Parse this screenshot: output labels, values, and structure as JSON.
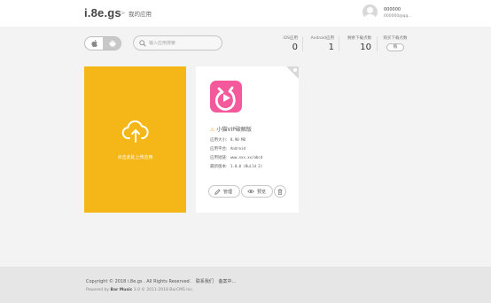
{
  "header": {
    "logo": "i.8e.gs",
    "separator": ">",
    "breadcrumb": "我的应用",
    "user_name": "000000",
    "user_email": "000000@qq..."
  },
  "toolbar": {
    "search_placeholder": "输入应用搜索"
  },
  "stats": [
    {
      "label": "iOS应用",
      "value": "0"
    },
    {
      "label": "Android应用",
      "value": "1"
    },
    {
      "label": "剩余下载点数",
      "value": "10"
    }
  ],
  "download_stat": {
    "label": "购买下载点数",
    "button": "购"
  },
  "upload": {
    "label": "点击此处上传应用"
  },
  "app": {
    "name": "小猫VIP破解版",
    "icon_color": "#f45a9b",
    "info": [
      {
        "key": "应用大小:",
        "value": "8.90 MB"
      },
      {
        "key": "应用平台:",
        "value": "Android"
      },
      {
        "key": "应用短链:",
        "value": "www.xxx.xx/abcd"
      },
      {
        "key": "最新版本:",
        "value": "1.0.0 (Build 2)"
      }
    ],
    "manage_label": "管理",
    "preview_label": "预览"
  },
  "footer": {
    "copyright": "Copyright © 2018 i.8e.gs . All Rights Reserved.",
    "contact": "联系我们",
    "record": "备案中...",
    "powered_prefix": "Powered by",
    "powered_brand": "Bar Music",
    "powered_suffix": "3.0 © 2011-2018 BarCMS Inc."
  },
  "colors": {
    "accent": "#f5b617",
    "app_icon": "#f45a9b"
  }
}
